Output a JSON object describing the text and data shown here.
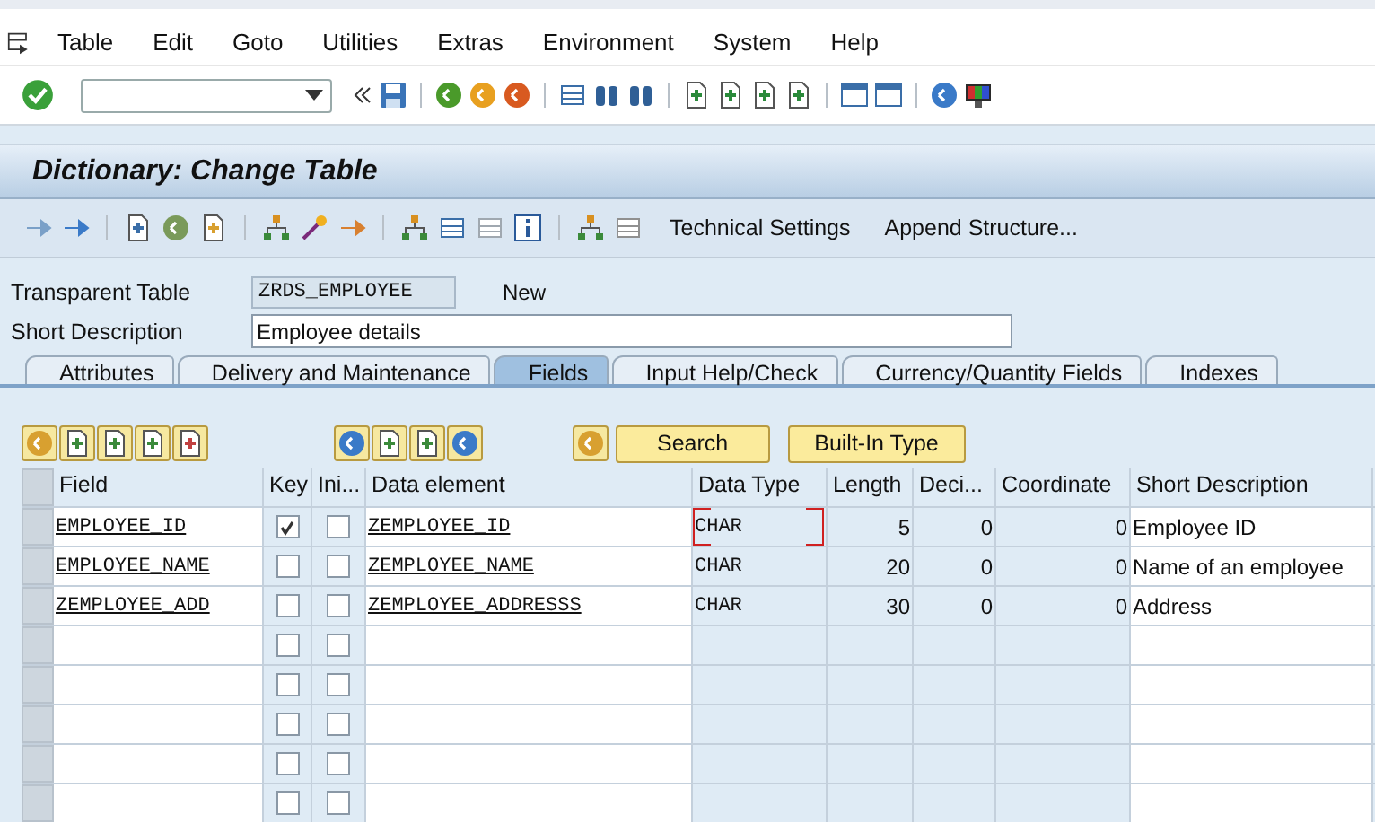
{
  "menu_bar": {
    "items": [
      "Table",
      "Edit",
      "Goto",
      "Utilities",
      "Extras",
      "Environment",
      "System",
      "Help"
    ]
  },
  "screen_title": "Dictionary: Change Table",
  "app_toolbar": {
    "buttons": [
      "Technical Settings",
      "Append Structure..."
    ]
  },
  "header": {
    "table_label": "Transparent Table",
    "table_value": "ZRDS_EMPLOYEE",
    "status": "New",
    "description_label": "Short Description",
    "description_value": "Employee details"
  },
  "tabs": [
    {
      "label": "Attributes",
      "selected": false
    },
    {
      "label": "Delivery and Maintenance",
      "selected": false
    },
    {
      "label": "Fields",
      "selected": true
    },
    {
      "label": "Input Help/Check",
      "selected": false
    },
    {
      "label": "Currency/Quantity Fields",
      "selected": false
    },
    {
      "label": "Indexes",
      "selected": false
    }
  ],
  "table_toolbar": {
    "buttons": [
      "Search",
      "Built-In Type"
    ]
  },
  "table": {
    "columns": [
      "Field",
      "Key",
      "Ini...",
      "Data element",
      "Data Type",
      "Length",
      "Deci...",
      "Coordinate",
      "Short Description"
    ],
    "rows": [
      {
        "field": "EMPLOYEE_ID",
        "key": true,
        "initial": false,
        "data_element": "ZEMPLOYEE_ID",
        "data_type": "CHAR",
        "length": "5",
        "decimals": "0",
        "coordinate": "0",
        "short_description": "Employee ID",
        "focused": true
      },
      {
        "field": "EMPLOYEE_NAME",
        "key": false,
        "initial": false,
        "data_element": "ZEMPLOYEE_NAME",
        "data_type": "CHAR",
        "length": "20",
        "decimals": "0",
        "coordinate": "0",
        "short_description": "Name of an employee",
        "focused": false
      },
      {
        "field": "ZEMPLOYEE_ADD",
        "key": false,
        "initial": false,
        "data_element": "ZEMPLOYEE_ADDRESSS",
        "data_type": "CHAR",
        "length": "30",
        "decimals": "0",
        "coordinate": "0",
        "short_description": "Address",
        "focused": false
      },
      {
        "key": false,
        "initial": false
      },
      {
        "key": false,
        "initial": false
      },
      {
        "key": false,
        "initial": false
      },
      {
        "key": false,
        "initial": false
      },
      {
        "key": false,
        "initial": false
      }
    ]
  }
}
